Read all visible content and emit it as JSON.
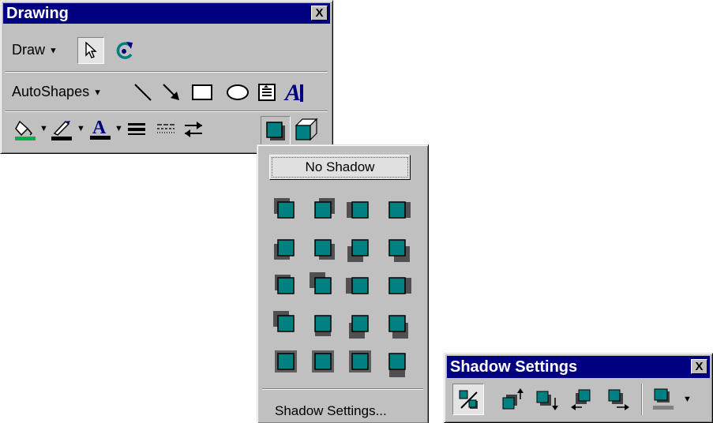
{
  "drawing_toolbar": {
    "title": "Drawing",
    "close_label": "X",
    "draw_menu": "Draw",
    "autoshapes_menu": "AutoShapes",
    "icons": {
      "select": "arrow-cursor-icon",
      "free_rotate": "free-rotate-icon",
      "line": "line-icon",
      "arrow": "arrow-icon",
      "rectangle": "rectangle-icon",
      "oval": "oval-icon",
      "text_box": "text-box-icon",
      "word_art": "wordart-icon",
      "fill_color": "fill-color-icon",
      "line_color": "line-color-icon",
      "font_color": "font-color-icon",
      "line_style": "line-style-icon",
      "dash_style": "dash-style-icon",
      "arrow_style": "arrow-style-icon",
      "shadow": "shadow-icon",
      "3d": "3d-icon"
    },
    "colors": {
      "fill": "#00b050",
      "line": "#000000",
      "font": "#000080",
      "accent": "#008080"
    }
  },
  "shadow_menu": {
    "no_shadow_label": "No Shadow",
    "settings_label": "Shadow Settings...",
    "styles_count_note": ""
  },
  "shadow_settings_toolbar": {
    "title": "Shadow Settings",
    "close_label": "X",
    "icons": [
      "shadow-on-off-icon",
      "nudge-shadow-up-icon",
      "nudge-shadow-down-icon",
      "nudge-shadow-left-icon",
      "nudge-shadow-right-icon",
      "shadow-color-icon"
    ]
  }
}
